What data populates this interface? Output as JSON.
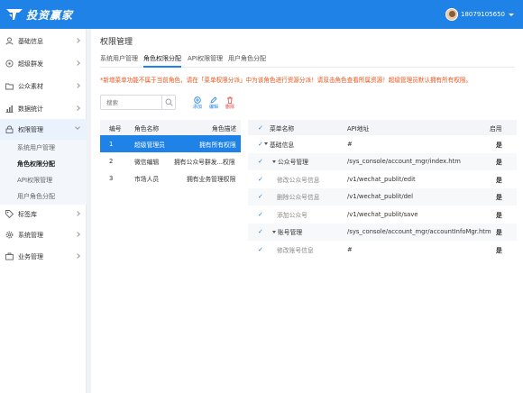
{
  "header": {
    "logo_text": "投资赢家",
    "phone": "18079105650"
  },
  "sidebar": {
    "items": [
      {
        "label": "基础信息"
      },
      {
        "label": "超级群发"
      },
      {
        "label": "公众素材"
      },
      {
        "label": "数据统计"
      },
      {
        "label": "权限管理"
      },
      {
        "label": "标签库"
      },
      {
        "label": "系统管理"
      },
      {
        "label": "业务管理"
      }
    ],
    "subitems": [
      {
        "label": "系统用户管理"
      },
      {
        "label": "角色权限分配"
      },
      {
        "label": "API权限管理"
      },
      {
        "label": "用户角色分配"
      }
    ]
  },
  "main": {
    "title": "权限管理",
    "tabs": [
      {
        "label": "系统用户管理"
      },
      {
        "label": "角色权限分配"
      },
      {
        "label": "API权限管理"
      },
      {
        "label": "用户角色分配"
      }
    ],
    "notice": "*新增菜单功能不属于当前角色，请在「菜单权限分派」中为该角色进行资源分派！请双击角色查看所属资源！超级管理员默认拥有所有权限。",
    "search_placeholder": "搜索",
    "tools": {
      "add": "添加",
      "edit": "编辑",
      "delete": "删除"
    }
  },
  "roles_table": {
    "headers": {
      "id": "编号",
      "name": "角色名称",
      "desc": "角色描述"
    },
    "rows": [
      {
        "id": "1",
        "name": "超级管理员",
        "desc": "拥有所有权限"
      },
      {
        "id": "2",
        "name": "微信编辑",
        "desc": "拥有公众号群发...权限"
      },
      {
        "id": "3",
        "name": "市场人员",
        "desc": "拥有业务管理权限"
      }
    ]
  },
  "menus_table": {
    "headers": {
      "check": "✓",
      "name": "菜单名称",
      "api": "API地址",
      "enabled": "启用"
    },
    "rows": [
      {
        "name": "基础信息",
        "api": "#",
        "enabled": "是"
      },
      {
        "name": "公众号管理",
        "api": "/sys_console/account_mgr/index.htm",
        "enabled": "是"
      },
      {
        "name": "修改公众号信息",
        "api": "/v1/wechat_publit/edit",
        "enabled": "是"
      },
      {
        "name": "删除公众号信息",
        "api": "/v1/wechat_publit/del",
        "enabled": "是"
      },
      {
        "name": "添加公众号",
        "api": "/v1/wechat_publit/save",
        "enabled": "是"
      },
      {
        "name": "账号管理",
        "api": "/sys_console/account_mgr/accountInfoMgr.htm",
        "enabled": "是"
      },
      {
        "name": "修改账号信息",
        "api": "#",
        "enabled": "是"
      }
    ]
  },
  "colors": {
    "primary": "#1f82e6",
    "notice": "#e8541b",
    "danger": "#e04848"
  }
}
